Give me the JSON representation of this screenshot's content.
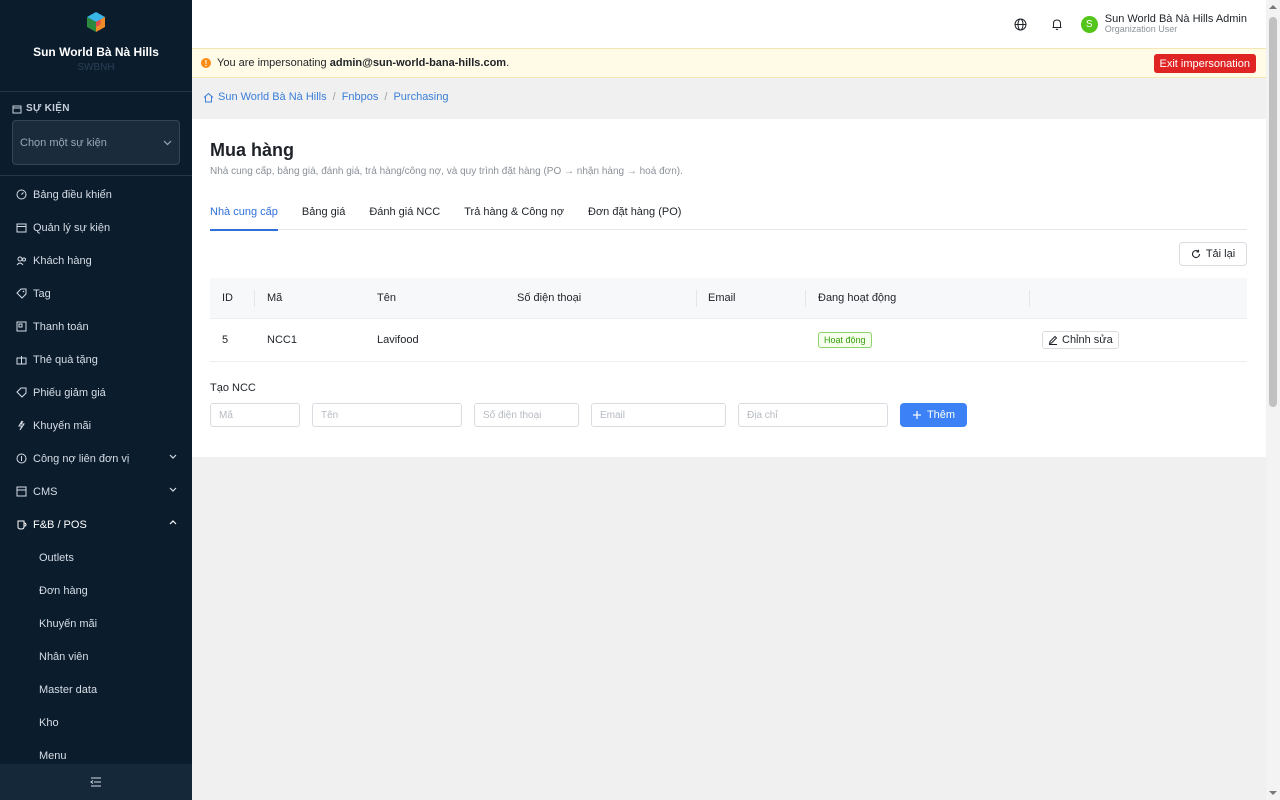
{
  "sidebar": {
    "brand_name": "Sun World Bà Nà Hills",
    "brand_sub": "SWBNH",
    "events_label": "SỰ KIỆN",
    "event_select_placeholder": "Chọn một sự kiện",
    "items": [
      {
        "label": "Bảng điều khiển",
        "icon": "dashboard-icon"
      },
      {
        "label": "Quản lý sự kiện",
        "icon": "calendar-icon"
      },
      {
        "label": "Khách hàng",
        "icon": "users-icon"
      },
      {
        "label": "Tag",
        "icon": "tag-icon"
      },
      {
        "label": "Thanh toán",
        "icon": "payment-icon"
      },
      {
        "label": "Thẻ quà tặng",
        "icon": "gift-icon"
      },
      {
        "label": "Phiếu giảm giá",
        "icon": "coupon-icon"
      },
      {
        "label": "Khuyến mãi",
        "icon": "promotion-icon"
      },
      {
        "label": "Công nợ liên đơn vị",
        "icon": "debt-icon"
      },
      {
        "label": "CMS",
        "icon": "cms-icon"
      },
      {
        "label": "F&B / POS",
        "icon": "fnb-icon"
      }
    ],
    "fnb_subitems": [
      "Outlets",
      "Đơn hàng",
      "Khuyến mãi",
      "Nhân viên",
      "Master data",
      "Kho",
      "Menu"
    ]
  },
  "header": {
    "user_name": "Sun World Bà Nà Hills Admin",
    "user_role": "Organization User",
    "avatar_letter": "S"
  },
  "banner": {
    "prefix": "You are impersonating ",
    "email": "admin@sun-world-bana-hills.com",
    "suffix": ".",
    "exit_label": "Exit impersonation"
  },
  "breadcrumb": {
    "home": "Sun World Bà Nà Hills",
    "level2": "Fnbpos",
    "level3": "Purchasing"
  },
  "page": {
    "title": "Mua hàng",
    "description": "Nhà cung cấp, bảng giá, đánh giá, trả hàng/công nợ, và quy trình đặt hàng (PO → nhận hàng → hoá đơn).",
    "tabs": [
      "Nhà cung cấp",
      "Bảng giá",
      "Đánh giá NCC",
      "Trả hàng & Công nợ",
      "Đơn đặt hàng (PO)"
    ],
    "reload_label": "Tải lại"
  },
  "table": {
    "headers": [
      "ID",
      "Mã",
      "Tên",
      "Số điện thoại",
      "Email",
      "Đang hoạt động"
    ],
    "rows": [
      {
        "id": "5",
        "code": "NCC1",
        "name": "Lavifood",
        "phone": "",
        "email": "",
        "status": "Hoạt động",
        "action": "Chỉnh sửa"
      }
    ]
  },
  "create_form": {
    "label": "Tạo NCC",
    "placeholders": [
      "Mã",
      "Tên",
      "Số điện thoại",
      "Email",
      "Địa chỉ"
    ],
    "submit_label": "Thêm"
  },
  "colors": {
    "sidebar_bg": "#0b1c2d",
    "accent": "#2f6fd8",
    "danger": "#e02424",
    "success": "#52c41a"
  }
}
